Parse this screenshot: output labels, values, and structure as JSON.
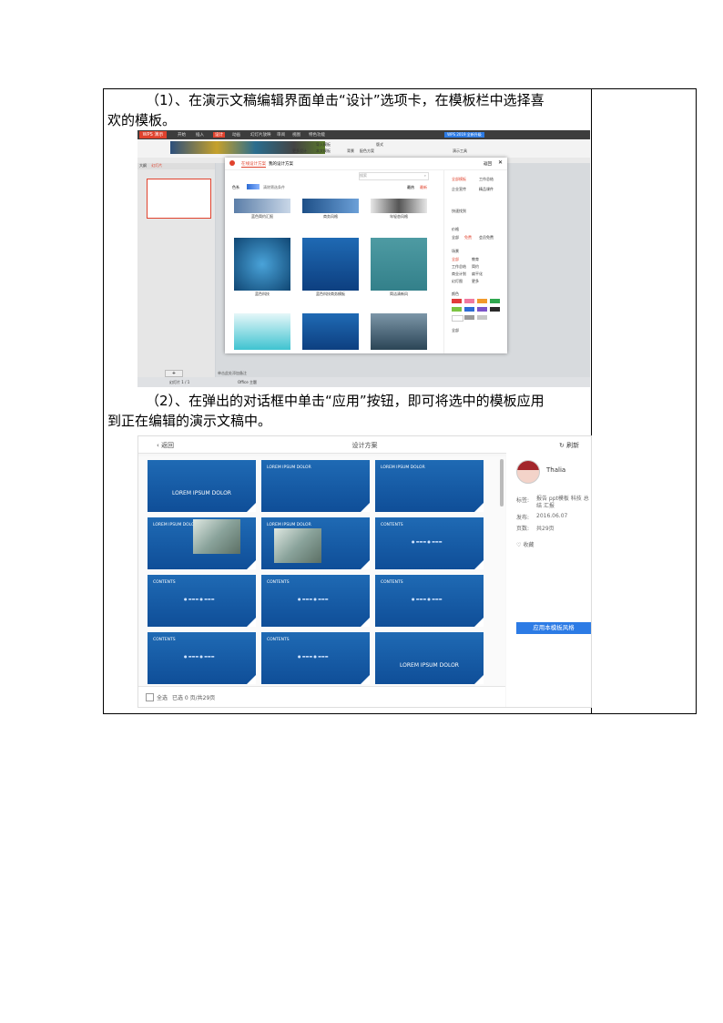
{
  "step1": {
    "text_line1": "（1）、在演示文稿编辑界面单击“设计”选项卡，在模板栏中选择喜",
    "text_line2": "欢的模板。"
  },
  "step2": {
    "text_line1": "（2）、在弹出的对话框中单击“应用”按钮，即可将选中的模板应用",
    "text_line2": "到正在编辑的演示文稿中。"
  },
  "screenshot1": {
    "app_logo": "WPS 演示",
    "ribbon_tabs": [
      "开始",
      "插入",
      "设计",
      "动画",
      "幻灯片放映",
      "审阅",
      "视图",
      "特色功能"
    ],
    "active_tab": "设计",
    "ribbon_right_button": "WPS 2019 全新升级",
    "ribbon_items": [
      "导入模板",
      "本文模板",
      "更多设计",
      "版式",
      "背景",
      "配色方案",
      "演示工具"
    ],
    "slide_pane_tabs": [
      "大纲",
      "幻灯片"
    ],
    "add_slide": "+",
    "status_left": "幻灯片 1 / 1",
    "status_mid": "Office 主题",
    "notes_hint": "单击此处添加备注",
    "dialog": {
      "tabs": [
        "在线设计方案",
        "我的设计方案"
      ],
      "search_placeholder": "搜索",
      "back": "返回",
      "filter_label": "色系",
      "filter_note": "清除筛选条件",
      "sort": [
        "最热",
        "最新"
      ],
      "templates": [
        {
          "caption": "蓝色简约汇报"
        },
        {
          "caption": "商务风格"
        },
        {
          "caption": "年轻态风格"
        },
        {
          "caption": "蓝色科技"
        },
        {
          "caption": "蓝色科技商务模板"
        },
        {
          "caption": "简洁清新风"
        },
        {
          "caption": ""
        },
        {
          "caption": ""
        },
        {
          "caption": ""
        }
      ],
      "side": {
        "checks": [
          "全部模板",
          "工作总结",
          "企业宣传",
          "精品课件"
        ],
        "quick_label": "快速找到",
        "group1_label": "价格",
        "group1": [
          "全部",
          "免费",
          "会员免费"
        ],
        "group2_label": "场景",
        "group2": [
          "全部",
          "教育",
          "工作总结",
          "简约",
          "商业计划",
          "扁平化",
          "幻灯图",
          "更多"
        ],
        "colors_label": "颜色",
        "colors": [
          "#e23b3b",
          "#f07aa0",
          "#f29a2b",
          "#2fa84f",
          "#7cc442",
          "#2c6bd4",
          "#7b53c9",
          "#2a2a2a",
          "#ffffff",
          "#9a9a9a",
          "#c7c7c7"
        ],
        "all_label": "全部"
      }
    }
  },
  "screenshot2": {
    "back": "返回",
    "title": "设计方案",
    "refresh": "刷新",
    "slides": [
      {
        "type": "cover",
        "title": "LOREM IPSUM DOLOR"
      },
      {
        "type": "text",
        "title": "LOREM IPSUM DOLOR"
      },
      {
        "type": "text",
        "title": "LOREM IPSUM DOLOR"
      },
      {
        "type": "photo",
        "title": "LOREM IPSUM DOLOR"
      },
      {
        "type": "photo",
        "title": "LOREM IPSUM DOLOR"
      },
      {
        "type": "contents",
        "title": "CONTENTS"
      },
      {
        "type": "contents",
        "title": "CONTENTS"
      },
      {
        "type": "contents",
        "title": "CONTENTS"
      },
      {
        "type": "contents",
        "title": "CONTENTS"
      },
      {
        "type": "contents",
        "title": "CONTENTS"
      },
      {
        "type": "contents",
        "title": "CONTENTS"
      },
      {
        "type": "cover2",
        "title": "LOREM IPSUM DOLOR"
      }
    ],
    "footer": {
      "select_all": "全选",
      "selected": "已选 0 页/共29页"
    },
    "side": {
      "author": "Thalia",
      "tags_label": "标签:",
      "tags_value": "报告 ppt模板 科技 总结 汇报",
      "date_label": "发布:",
      "date_value": "2016.06.07",
      "pages_label": "页数:",
      "pages_value": "共29页",
      "favorite": "收藏",
      "apply_button": "应用本模板风格"
    }
  }
}
